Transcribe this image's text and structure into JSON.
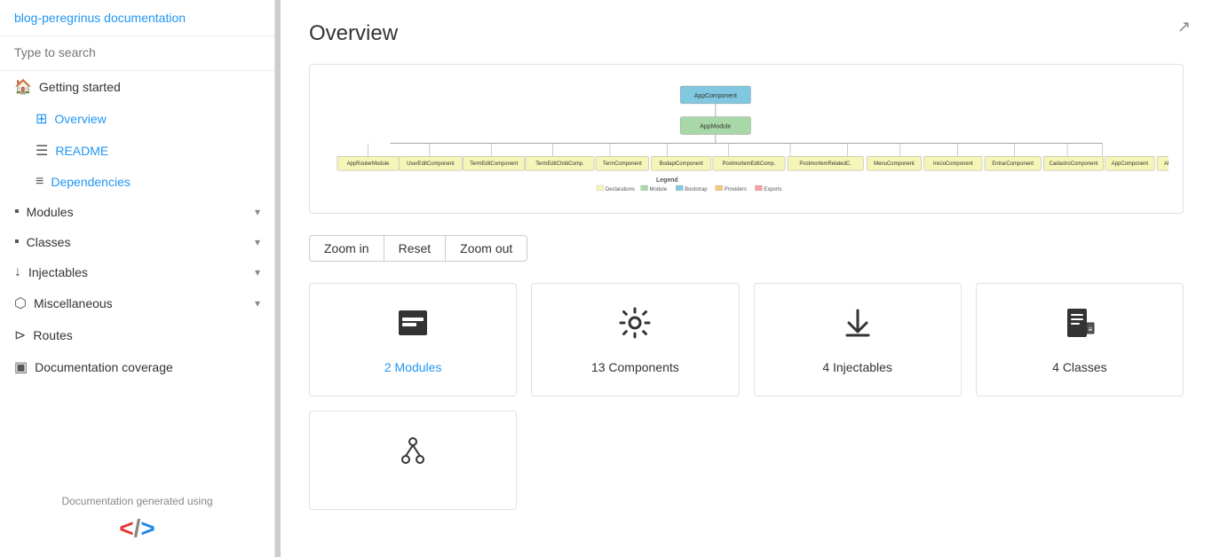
{
  "sidebar": {
    "title": "blog-peregrinus documentation",
    "search_placeholder": "Type to search",
    "items": [
      {
        "id": "getting-started",
        "label": "Getting started",
        "icon": "🏠",
        "active": false,
        "sub": false
      },
      {
        "id": "overview",
        "label": "Overview",
        "icon": "⊞",
        "active": true,
        "sub": true
      },
      {
        "id": "readme",
        "label": "README",
        "icon": "☰",
        "active": false,
        "sub": true
      },
      {
        "id": "dependencies",
        "label": "Dependencies",
        "icon": "≡",
        "active": false,
        "sub": true
      },
      {
        "id": "modules",
        "label": "Modules",
        "icon": "▪",
        "active": false,
        "hasChevron": true
      },
      {
        "id": "classes",
        "label": "Classes",
        "icon": "▪",
        "active": false,
        "hasChevron": true
      },
      {
        "id": "injectables",
        "label": "Injectables",
        "icon": "↓",
        "active": false,
        "hasChevron": true
      },
      {
        "id": "miscellaneous",
        "label": "Miscellaneous",
        "icon": "⬡",
        "active": false,
        "hasChevron": true
      },
      {
        "id": "routes",
        "label": "Routes",
        "icon": "⊳",
        "active": false
      },
      {
        "id": "doc-coverage",
        "label": "Documentation coverage",
        "icon": "▣",
        "active": false
      }
    ],
    "footer": "Documentation generated using"
  },
  "main": {
    "title": "Overview",
    "expand_icon": "↗",
    "zoom_controls": {
      "zoom_in": "Zoom in",
      "reset": "Reset",
      "zoom_out": "Zoom out"
    },
    "legend": {
      "items": [
        {
          "label": "Declarations",
          "color": "#f5f5b8"
        },
        {
          "label": "Module",
          "color": "#a8d8a8"
        },
        {
          "label": "Bootstrap",
          "color": "#80c8e0"
        },
        {
          "label": "Providers",
          "color": "#f5c87a"
        },
        {
          "label": "Exports",
          "color": "#f5a0a0"
        }
      ]
    },
    "cards": [
      {
        "id": "modules-card",
        "icon": "modules",
        "label": "2 Modules",
        "link": true
      },
      {
        "id": "components-card",
        "icon": "components",
        "label": "13 Components",
        "link": false
      },
      {
        "id": "injectables-card",
        "icon": "injectables",
        "label": "4 Injectables",
        "link": false
      },
      {
        "id": "classes-card",
        "icon": "classes",
        "label": "4 Classes",
        "link": false
      }
    ],
    "cards2": [
      {
        "id": "routes-card",
        "icon": "routes",
        "label": "",
        "link": false
      }
    ],
    "diagram": {
      "app_component": "AppComponent",
      "app_module": "AppModule",
      "nodes": [
        "AppRouterModule",
        "UserEditComponent",
        "TermEditComponent",
        "TermEditChildComponent",
        "TermComponent",
        "BodapiComponent",
        "PostmortemEditComponent",
        "PostmortemRelatedComponent",
        "MenuComponent",
        "InicioComponent",
        "EntrarComponent",
        "CadastroComponent",
        "AppComponent",
        "AlternarComponent"
      ]
    }
  }
}
